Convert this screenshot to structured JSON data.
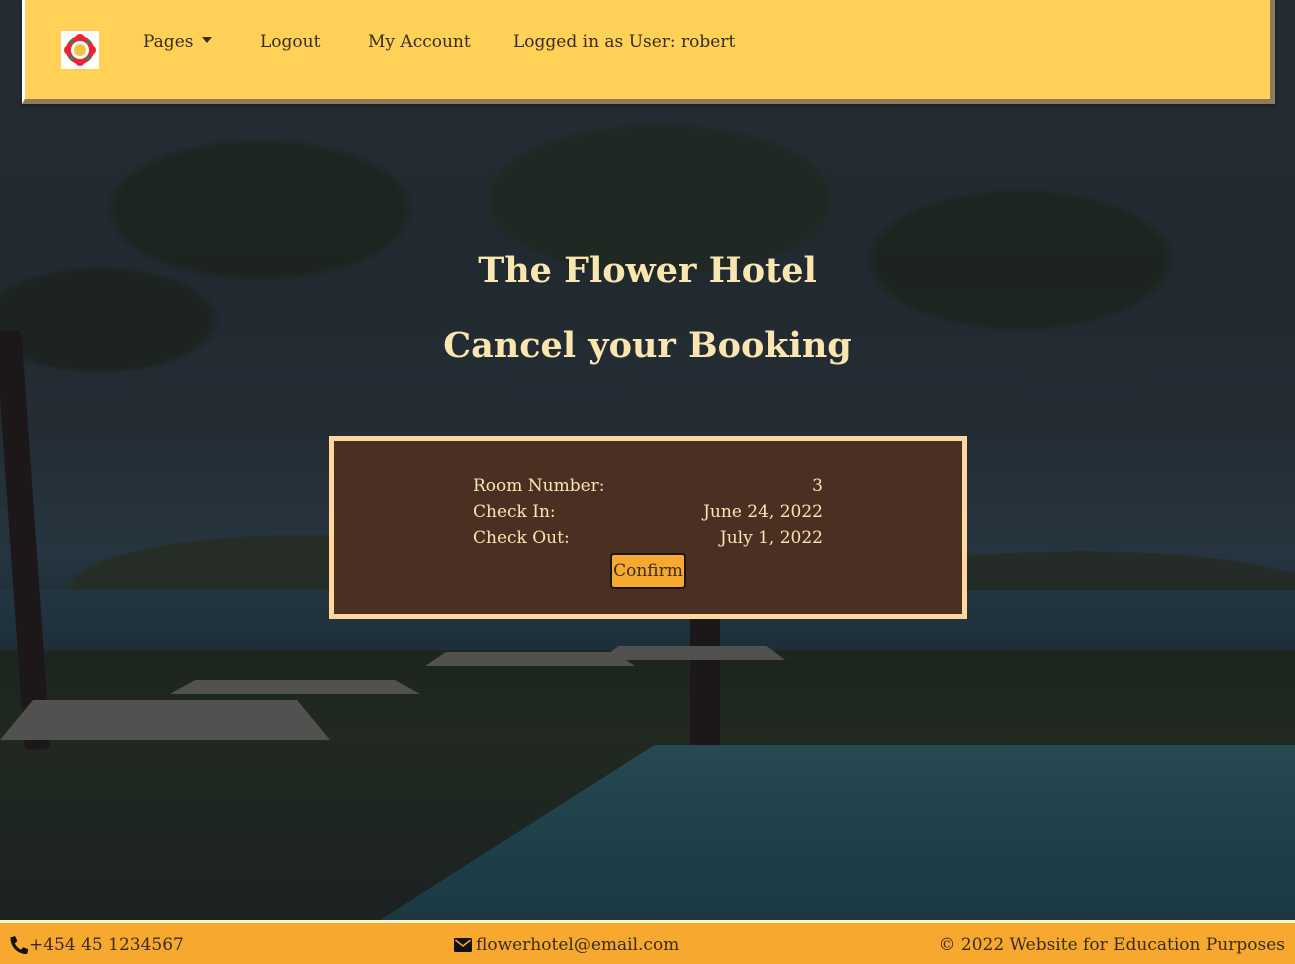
{
  "navbar": {
    "logo_name": "flower-logo",
    "pages_label": "Pages",
    "logout_label": "Logout",
    "account_label": "My Account",
    "logged_in_text": "Logged in as User: robert"
  },
  "hero": {
    "site_title": "The Flower Hotel",
    "page_heading": "Cancel your Booking"
  },
  "booking": {
    "room_label": "Room Number:",
    "room_value": "3",
    "checkin_label": "Check In:",
    "checkin_value": "June 24, 2022",
    "checkout_label": "Check Out:",
    "checkout_value": "July 1, 2022",
    "confirm_label": "Confirm"
  },
  "footer": {
    "phone_icon": "phone-icon",
    "phone": "+454 45 1234567",
    "email_icon": "envelope-icon",
    "email": "flowerhotel@email.com",
    "copyright": "© 2022 Website for Education Purposes"
  },
  "colors": {
    "navbar_bg": "#ffd157",
    "footer_bg": "#f6a92e",
    "card_bg": "#4a2f22",
    "card_border": "#fed89a",
    "heading_text": "#fbe6b0",
    "button_bg": "#f6a92e"
  }
}
